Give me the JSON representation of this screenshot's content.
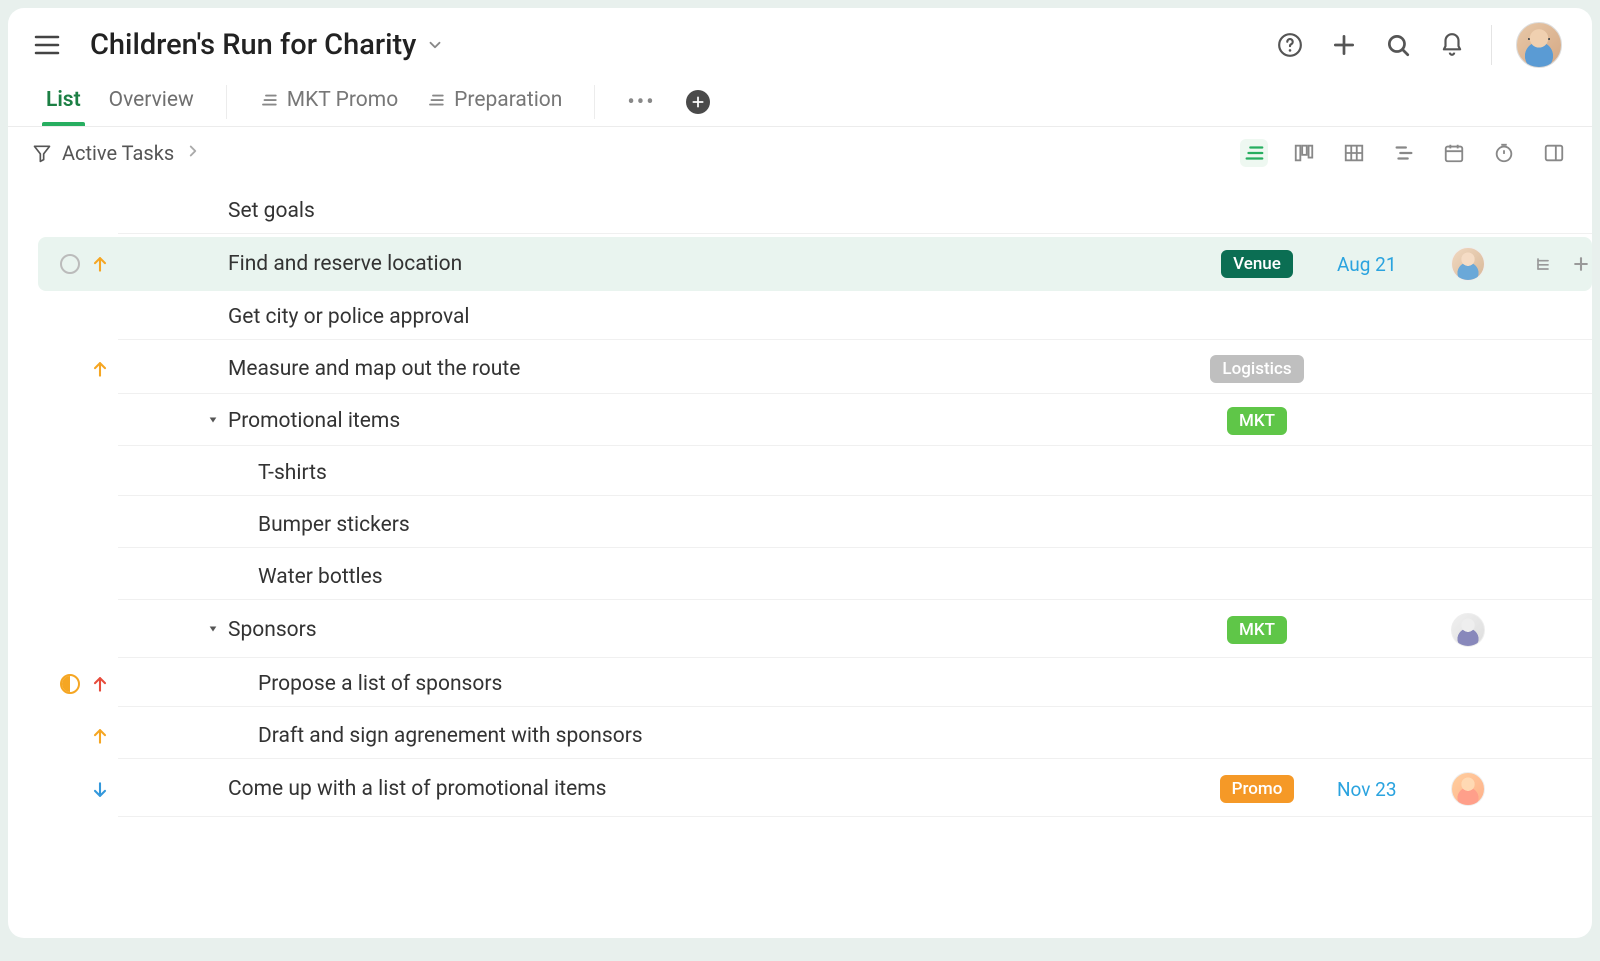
{
  "header": {
    "project_title": "Children's Run for Charity"
  },
  "tabs": {
    "list": "List",
    "overview": "Overview",
    "mkt_promo": "MKT Promo",
    "preparation": "Preparation"
  },
  "toolbar": {
    "filter_label": "Active Tasks"
  },
  "tags": {
    "venue": "Venue",
    "logistics": "Logistics",
    "mkt": "MKT",
    "promo": "Promo"
  },
  "tasks": [
    {
      "name": "Set goals",
      "indent": 0,
      "priority": null,
      "status": null,
      "tag": null,
      "date": null,
      "avatar": null,
      "expand": null,
      "highlight": false,
      "actions": false
    },
    {
      "name": "Find and reserve location",
      "indent": 0,
      "priority": "up-orange",
      "status": "open",
      "tag": "venue",
      "date": "Aug 21",
      "avatar": "a1",
      "expand": null,
      "highlight": true,
      "actions": true
    },
    {
      "name": "Get city or police approval",
      "indent": 0,
      "priority": null,
      "status": null,
      "tag": null,
      "date": null,
      "avatar": null,
      "expand": null,
      "highlight": false,
      "actions": false
    },
    {
      "name": "Measure and map out the route",
      "indent": 0,
      "priority": "up-orange",
      "status": null,
      "tag": "logistics",
      "date": null,
      "avatar": null,
      "expand": null,
      "highlight": false,
      "actions": false
    },
    {
      "name": "Promotional items",
      "indent": 0,
      "priority": null,
      "status": null,
      "tag": "mkt",
      "date": null,
      "avatar": null,
      "expand": "open",
      "highlight": false,
      "actions": false
    },
    {
      "name": "T-shirts",
      "indent": 1,
      "priority": null,
      "status": null,
      "tag": null,
      "date": null,
      "avatar": null,
      "expand": null,
      "highlight": false,
      "actions": false
    },
    {
      "name": "Bumper stickers",
      "indent": 1,
      "priority": null,
      "status": null,
      "tag": null,
      "date": null,
      "avatar": null,
      "expand": null,
      "highlight": false,
      "actions": false
    },
    {
      "name": "Water bottles",
      "indent": 1,
      "priority": null,
      "status": null,
      "tag": null,
      "date": null,
      "avatar": null,
      "expand": null,
      "highlight": false,
      "actions": false
    },
    {
      "name": "Sponsors",
      "indent": 0,
      "priority": null,
      "status": null,
      "tag": "mkt",
      "date": null,
      "avatar": "a2",
      "expand": "open",
      "highlight": false,
      "actions": false
    },
    {
      "name": "Propose a list of sponsors",
      "indent": 1,
      "priority": "up-red",
      "status": "half",
      "tag": null,
      "date": null,
      "avatar": null,
      "expand": null,
      "highlight": false,
      "actions": false
    },
    {
      "name": "Draft and sign agrenement with sponsors",
      "indent": 1,
      "priority": "up-orange",
      "status": null,
      "tag": null,
      "date": null,
      "avatar": null,
      "expand": null,
      "highlight": false,
      "actions": false
    },
    {
      "name": "Come up with a list of promotional items",
      "indent": 0,
      "priority": "down-blue",
      "status": null,
      "tag": "promo",
      "date": "Nov 23",
      "avatar": "a3",
      "expand": null,
      "highlight": false,
      "actions": false
    }
  ]
}
